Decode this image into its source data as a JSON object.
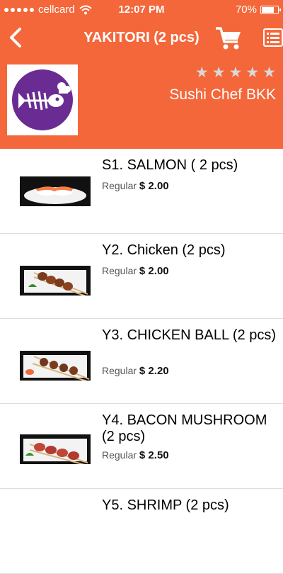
{
  "status_bar": {
    "carrier": "cellcard",
    "time": "12:07 PM",
    "battery": "70%",
    "battery_level": 0.7
  },
  "nav": {
    "title": "YAKITORI (2 pcs)"
  },
  "restaurant": {
    "name": "Sushi Chef BKK",
    "rating_stars": 5,
    "star_glyph": "★"
  },
  "colors": {
    "header": "#f4673a",
    "logo": "#6a2c93"
  },
  "items": [
    {
      "name": "S1. SALMON ( 2 pcs)",
      "size": "Regular",
      "price": "$ 2.00"
    },
    {
      "name": "Y2. Chicken (2 pcs)",
      "size": "Regular",
      "price": "$ 2.00"
    },
    {
      "name": "Y3. CHICKEN BALL (2 pcs)",
      "size": "Regular",
      "price": "$ 2.20"
    },
    {
      "name": "Y4. BACON MUSHROOM (2 pcs)",
      "size": "Regular",
      "price": "$ 2.50"
    },
    {
      "name": "Y5. SHRIMP (2 pcs)"
    }
  ]
}
